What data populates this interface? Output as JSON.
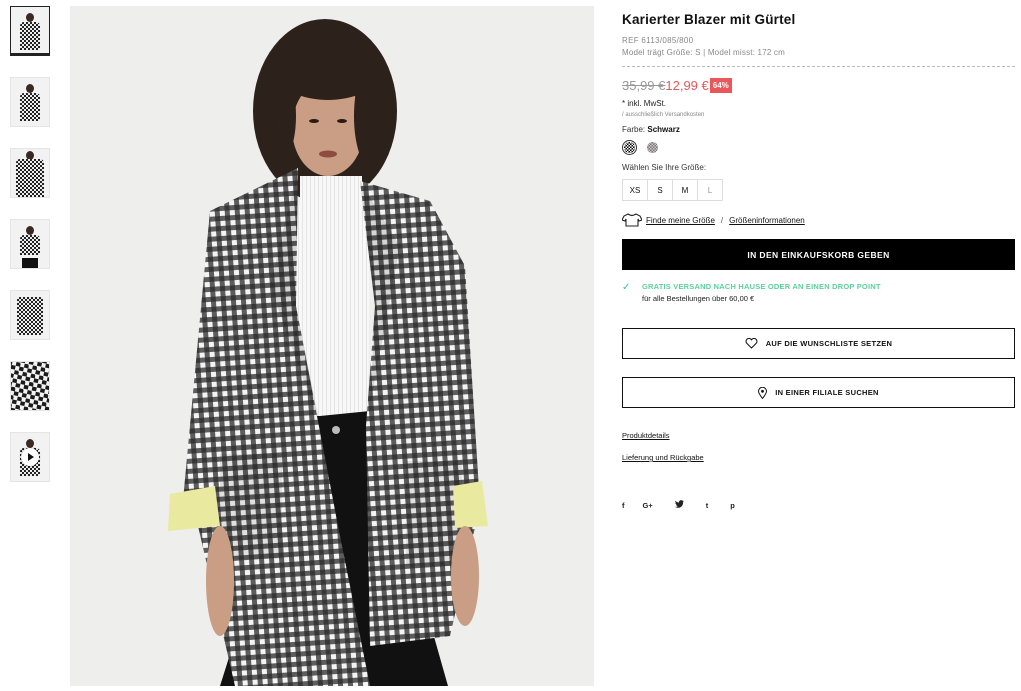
{
  "product": {
    "title": "Karierter Blazer mit Gürtel",
    "ref": "REF 6113/085/800",
    "model_info": "Model trägt Größe: S | Model misst: 172 cm",
    "old_price": "35,99 €",
    "new_price": "12,99 €",
    "discount": "64%",
    "tax_note": "* inkl. MwSt.",
    "shipping_note": "/ ausschließlich Versandkosten",
    "color_label": "Farbe:",
    "color_value": "Schwarz",
    "size_label": "Wählen Sie Ihre Größe:",
    "sizes": [
      "XS",
      "S",
      "M",
      "L"
    ],
    "find_size": "Finde meine Größe",
    "size_info": "Größeninformationen",
    "sep": "/"
  },
  "actions": {
    "add_to_cart": "IN DEN EINKAUFSKORB GEBEN",
    "wishlist": "AUF DIE WUNSCHLISTE SETZEN",
    "store": "IN EINER FILIALE SUCHEN"
  },
  "shipping": {
    "title": "GRATIS VERSAND NACH HAUSE ODER AN EINEN DROP POINT",
    "subtitle": "für alle Bestellungen über 60,00 €"
  },
  "links": {
    "details": "Produktdetails",
    "delivery": "Lieferung und Rückgabe"
  },
  "social": [
    "f",
    "G+",
    "t",
    "t",
    "p"
  ],
  "colors": {
    "accent_sale": "#e8585a",
    "free_ship": "#5fcf9d",
    "button_bg": "#000000"
  }
}
